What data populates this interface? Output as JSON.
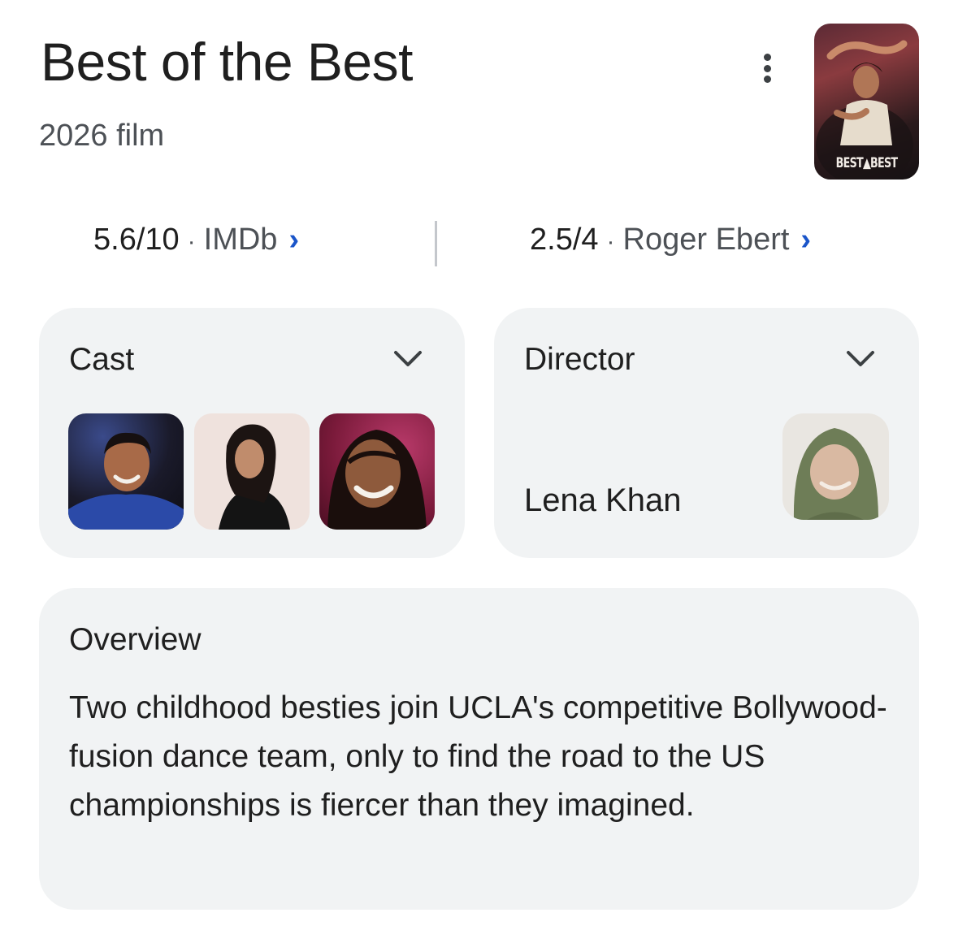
{
  "header": {
    "title": "Best of the Best",
    "subtitle": "2026 film",
    "more_icon": "more-vert-icon",
    "poster_text": "BEST▲BEST"
  },
  "ratings": [
    {
      "score": "5.6/10",
      "separator": "·",
      "source": "IMDb",
      "chevron": "›"
    },
    {
      "score": "2.5/4",
      "separator": "·",
      "source": "Roger Ebert",
      "chevron": "›"
    }
  ],
  "cast": {
    "title": "Cast",
    "expand_icon": "chevron-down-icon",
    "members": [
      "cast-avatar-1",
      "cast-avatar-2",
      "cast-avatar-3"
    ]
  },
  "director": {
    "title": "Director",
    "expand_icon": "chevron-down-icon",
    "name": "Lena Khan"
  },
  "overview": {
    "title": "Overview",
    "text": "Two childhood besties join UCLA's competitive Bollywood-fusion dance team, only to find the road to the US championships is fiercer than they imagined."
  },
  "colors": {
    "link_chevron": "#1a55c9",
    "card_bg": "#f1f3f4",
    "secondary_text": "#4d5156"
  }
}
